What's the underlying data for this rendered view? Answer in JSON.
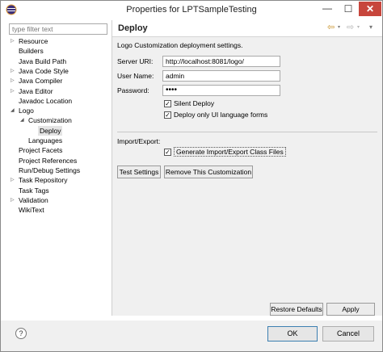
{
  "window": {
    "title": "Properties for LPTSampleTesting",
    "minimize": "—",
    "maximize": "☐",
    "close": "✕"
  },
  "filter": {
    "placeholder": "type filter text"
  },
  "tree": [
    {
      "label": "Resource",
      "arrow": "▷"
    },
    {
      "label": "Builders",
      "arrow": ""
    },
    {
      "label": "Java Build Path",
      "arrow": ""
    },
    {
      "label": "Java Code Style",
      "arrow": "▷"
    },
    {
      "label": "Java Compiler",
      "arrow": "▷"
    },
    {
      "label": "Java Editor",
      "arrow": "▷"
    },
    {
      "label": "Javadoc Location",
      "arrow": ""
    },
    {
      "label": "Logo",
      "arrow": "◢"
    },
    {
      "label": "Customization",
      "arrow": "◢"
    },
    {
      "label": "Deploy",
      "arrow": ""
    },
    {
      "label": "Languages",
      "arrow": ""
    },
    {
      "label": "Project Facets",
      "arrow": ""
    },
    {
      "label": "Project References",
      "arrow": ""
    },
    {
      "label": "Run/Debug Settings",
      "arrow": ""
    },
    {
      "label": "Task Repository",
      "arrow": "▷"
    },
    {
      "label": "Task Tags",
      "arrow": ""
    },
    {
      "label": "Validation",
      "arrow": "▷"
    },
    {
      "label": "WikiText",
      "arrow": ""
    }
  ],
  "page": {
    "title": "Deploy",
    "description": "Logo Customization deployment settings.",
    "nav_back": "⇦",
    "nav_forward": "⇨",
    "nav_dropdown": "▾"
  },
  "form": {
    "server_uri_label": "Server URI:",
    "server_uri_value": "http://localhost:8081/logo/",
    "user_name_label": "User Name:",
    "user_name_value": "admin",
    "password_label": "Password:",
    "password_value": "••••",
    "silent_deploy": {
      "label": "Silent Deploy",
      "checked": true
    },
    "deploy_ui_forms": {
      "label": "Deploy only UI language forms",
      "checked": true
    }
  },
  "import_export": {
    "label": "Import/Export:",
    "generate": {
      "label": "Generate Import/Export Class Files",
      "checked": true
    }
  },
  "buttons": {
    "test_settings": "Test Settings",
    "remove_customization": "Remove This Customization",
    "restore_defaults": "Restore Defaults",
    "apply": "Apply",
    "ok": "OK",
    "cancel": "Cancel",
    "help": "?"
  },
  "check_mark": "✓"
}
